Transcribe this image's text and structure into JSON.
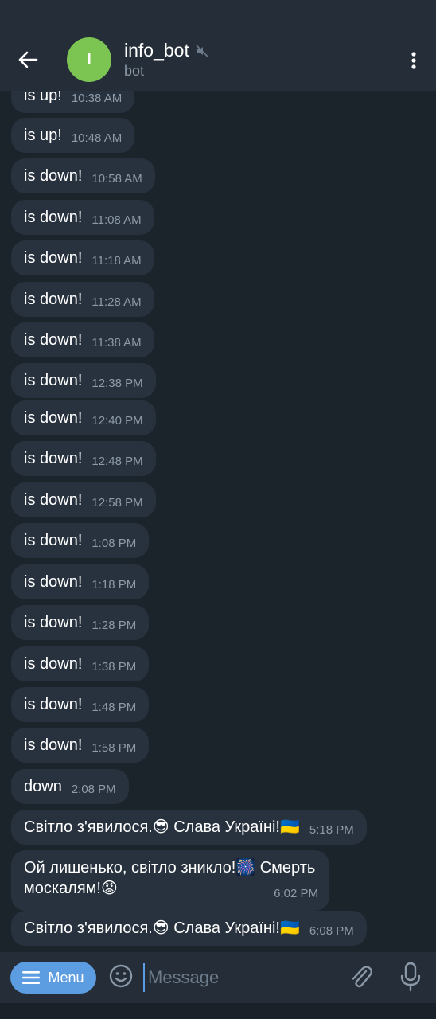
{
  "header": {
    "avatar_letter": "I",
    "title": "info_bot",
    "subtitle": "bot",
    "muted_icon": "muted-speaker-icon"
  },
  "messages": [
    {
      "text": "is up!",
      "time": "10:38 AM"
    },
    {
      "text": "is up!",
      "time": "10:48 AM"
    },
    {
      "text": "is down!",
      "time": "10:58 AM"
    },
    {
      "text": "is down!",
      "time": "11:08 AM"
    },
    {
      "text": "is down!",
      "time": "11:18 AM"
    },
    {
      "text": "is down!",
      "time": "11:28 AM"
    },
    {
      "text": "is down!",
      "time": "11:38 AM"
    },
    {
      "text": "is down!",
      "time": "12:38 PM"
    },
    {
      "text": "is down!",
      "time": "12:40 PM"
    },
    {
      "text": "is down!",
      "time": "12:48 PM"
    },
    {
      "text": "is down!",
      "time": "12:58 PM"
    },
    {
      "text": "is down!",
      "time": "1:08 PM"
    },
    {
      "text": "is down!",
      "time": "1:18 PM"
    },
    {
      "text": "is down!",
      "time": "1:28 PM"
    },
    {
      "text": "is down!",
      "time": "1:38 PM"
    },
    {
      "text": "is down!",
      "time": "1:48 PM"
    },
    {
      "text": "is down!",
      "time": "1:58 PM"
    },
    {
      "text": "down",
      "time": "2:08 PM"
    },
    {
      "text": "Світло з'явилося.😎 Слава Україні!🇺🇦",
      "time": "5:18 PM"
    },
    {
      "text": "Ой лишенько, світло зникло!🎆 Смерть москалям!😡",
      "time": "6:02 PM"
    },
    {
      "text": "Світло з'явилося.😎 Слава Україні!🇺🇦",
      "time": "6:08 PM"
    }
  ],
  "composer": {
    "menu_label": "Menu",
    "placeholder": "Message"
  },
  "colors": {
    "accent": "#5c9ce0",
    "avatar": "#7dc553",
    "bubble": "#28323e",
    "header": "#242d38"
  }
}
